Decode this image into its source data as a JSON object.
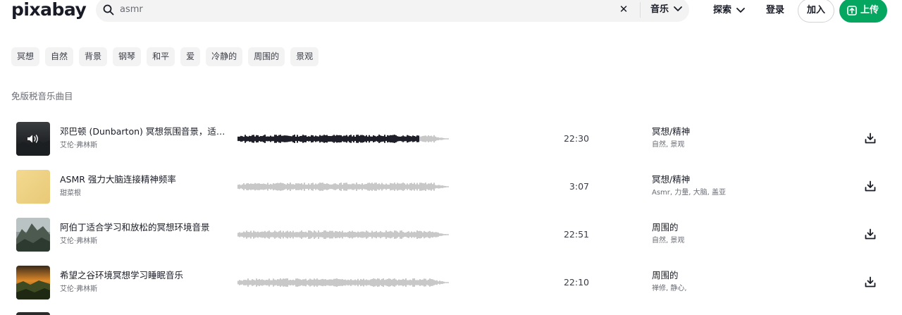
{
  "header": {
    "logo": "pixabay",
    "search_value": "asmr",
    "search_type": "音乐",
    "explore_label": "探索",
    "login_label": "登录",
    "join_label": "加入",
    "upload_label": "上传"
  },
  "tags": [
    "冥想",
    "自然",
    "背景",
    "钢琴",
    "和平",
    "爱",
    "冷静的",
    "周围的",
    "景观"
  ],
  "section_title": "免版税音乐曲目",
  "tracks": [
    {
      "title": "邓巴顿 (Dunbarton) 冥想氛围音景，适合学...",
      "artist": "艾伦·弗林斯",
      "duration": "22:30",
      "genre": "冥想/精神",
      "tags": "自然, 景观",
      "played_fraction": 0.86,
      "thumbnail": "dark-speaker"
    },
    {
      "title": "ASMR 强力大脑连接精神频率",
      "artist": "甜菜根",
      "duration": "3:07",
      "genre": "冥想/精神",
      "tags": "Asmr, 力量, 大脑, 盖亚",
      "played_fraction": 0,
      "thumbnail": "yellow"
    },
    {
      "title": "阿伯丁适合学习和放松的冥想环境音景",
      "artist": "艾伦·弗林斯",
      "duration": "22:51",
      "genre": "周围的",
      "tags": "自然, 景观",
      "played_fraction": 0,
      "thumbnail": "mountain"
    },
    {
      "title": "希望之谷环境冥想学习睡眠音乐",
      "artist": "艾伦·弗林斯",
      "duration": "22:10",
      "genre": "周围的",
      "tags": "禅修, 静心,",
      "played_fraction": 0,
      "thumbnail": "sunset"
    }
  ],
  "colors": {
    "accent": "#04a660",
    "wave_played": "#1e1f29",
    "wave_unplayed": "#c8c8c8"
  }
}
